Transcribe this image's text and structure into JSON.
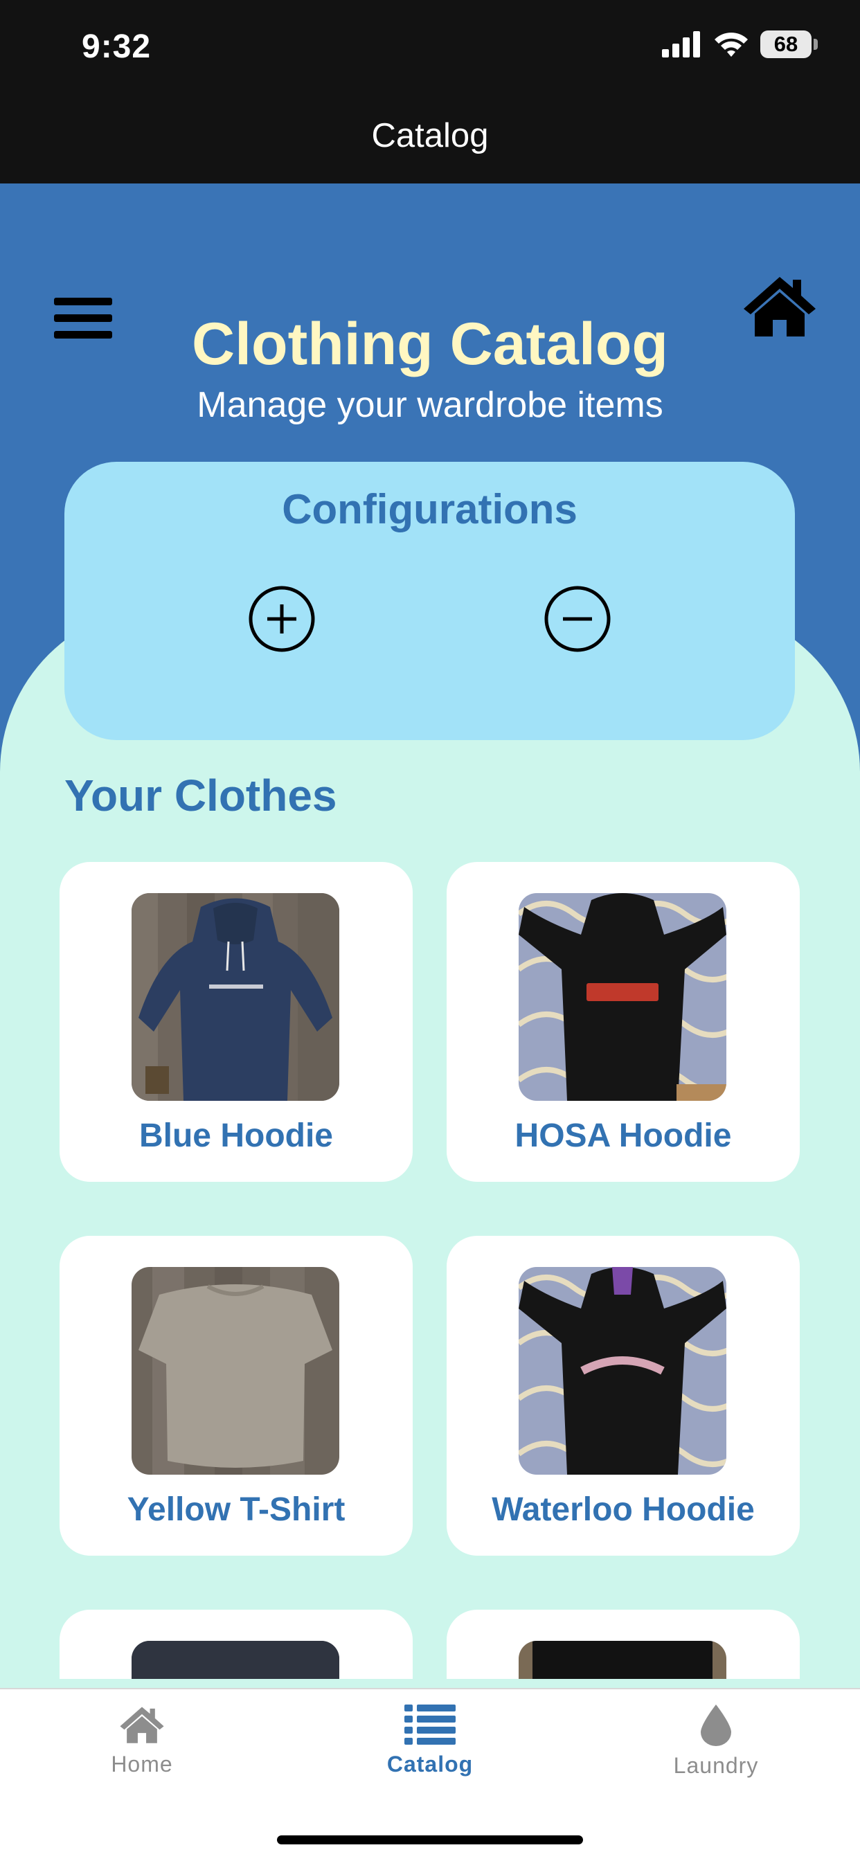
{
  "status_bar": {
    "time": "9:32",
    "battery": "68",
    "icons": [
      "cellular-signal-icon",
      "wifi-icon",
      "battery-icon"
    ]
  },
  "nav_bar": {
    "title": "Catalog"
  },
  "header": {
    "title": "Clothing Catalog",
    "subtitle": "Manage your wardrobe items",
    "menu_icon": "hamburger-menu-icon",
    "home_icon": "home-icon"
  },
  "configurations": {
    "title": "Configurations",
    "add_icon": "plus-circle-icon",
    "remove_icon": "minus-circle-icon"
  },
  "clothes": {
    "section_title": "Your Clothes",
    "items": [
      {
        "label": "Blue Hoodie",
        "image": "photo-navy-hoodie-on-wood-floor"
      },
      {
        "label": "HOSA Hoodie",
        "image": "photo-black-hoodie-on-patterned-blanket"
      },
      {
        "label": "Yellow T-Shirt",
        "image": "photo-tshirt-on-wood-floor"
      },
      {
        "label": "Waterloo Hoodie",
        "image": "photo-black-hoodie-on-patterned-blanket"
      },
      {
        "label": "",
        "image": "photo-dark-garment-partially-visible"
      },
      {
        "label": "",
        "image": "photo-black-garment-partially-visible"
      }
    ]
  },
  "tab_bar": {
    "tabs": [
      {
        "label": "Home",
        "icon": "home-icon",
        "active": false
      },
      {
        "label": "Catalog",
        "icon": "list-icon",
        "active": true
      },
      {
        "label": "Laundry",
        "icon": "water-drop-icon",
        "active": false
      }
    ]
  },
  "colors": {
    "header_blue": "#3a74b6",
    "mint_background": "#cdf6ec",
    "config_card": "#a2e2f8",
    "title_yellow": "#fff7c2",
    "accent_blue": "#3272b2",
    "tab_inactive": "#8d8d8d"
  }
}
